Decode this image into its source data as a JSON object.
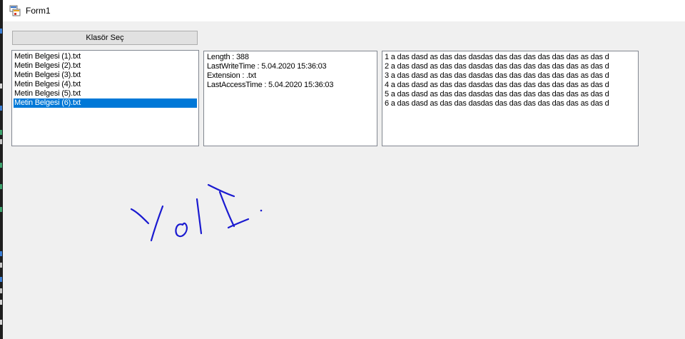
{
  "window": {
    "title": "Form1"
  },
  "toolbar": {
    "select_folder_label": "Klasör Seç"
  },
  "file_list": {
    "items": [
      "Metin Belgesi (1).txt",
      "Metin Belgesi (2).txt",
      "Metin Belgesi (3).txt",
      "Metin Belgesi (4).txt",
      "Metin Belgesi (5).txt",
      "Metin Belgesi (6).txt"
    ],
    "selected_index": 5
  },
  "file_info": {
    "lines": [
      "Length : 388",
      "LastWriteTime : 5.04.2020 15:36:03",
      "Extension : .txt",
      "LastAccessTime : 5.04.2020 15:36:03"
    ]
  },
  "file_content": {
    "lines": [
      "1 a das dasd as das das dasdas das das das das das das as das d",
      "2 a das dasd as das das dasdas das das das das das das as das d",
      "3 a das dasd as das das dasdas das das das das das das as das d",
      "4 a das dasd as das das dasdas das das das das das das as das d",
      "5 a das dasd as das das dasdas das das das das das das as das d",
      "6 a das dasd as das das dasdas das das das das das das as das d"
    ]
  },
  "annotation": {
    "handwritten_text": "Yol I."
  },
  "colors": {
    "selection": "#0078d7",
    "window_bg": "#f0f0f0",
    "ink": "#1a1ad0"
  }
}
